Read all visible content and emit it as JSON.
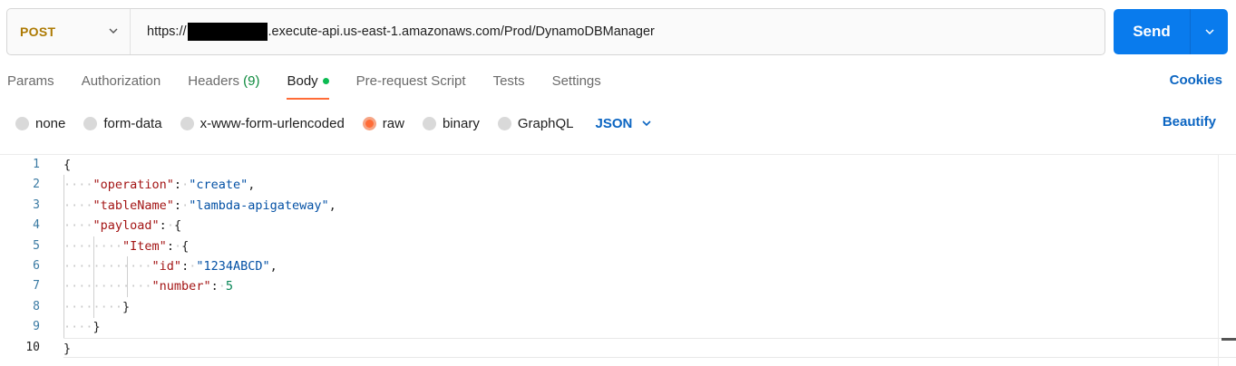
{
  "request": {
    "method": "POST",
    "url_prefix": "https://",
    "url_suffix": ".execute-api.us-east-1.amazonaws.com/Prod/DynamoDBManager",
    "send_label": "Send"
  },
  "tabs": [
    {
      "label": "Params"
    },
    {
      "label": "Authorization"
    },
    {
      "label": "Headers",
      "count": "(9)"
    },
    {
      "label": "Body"
    },
    {
      "label": "Pre-request Script"
    },
    {
      "label": "Tests"
    },
    {
      "label": "Settings"
    }
  ],
  "cookies_label": "Cookies",
  "body_types": [
    "none",
    "form-data",
    "x-www-form-urlencoded",
    "raw",
    "binary",
    "GraphQL"
  ],
  "selected_body_type": "raw",
  "language": "JSON",
  "beautify_label": "Beautify",
  "line_numbers": [
    "1",
    "2",
    "3",
    "4",
    "5",
    "6",
    "7",
    "8",
    "9",
    "10"
  ],
  "code": {
    "operation_key": "\"operation\"",
    "operation_val": "\"create\"",
    "table_key": "\"tableName\"",
    "table_val": "\"lambda-apigateway\"",
    "payload_key": "\"payload\"",
    "item_key": "\"Item\"",
    "id_key": "\"id\"",
    "id_val": "\"1234ABCD\"",
    "number_key": "\"number\"",
    "number_val": "5"
  },
  "colors": {
    "accent": "#ff6c37",
    "send": "#097bed",
    "link": "#0b65c2",
    "method": "#ad7a03"
  }
}
